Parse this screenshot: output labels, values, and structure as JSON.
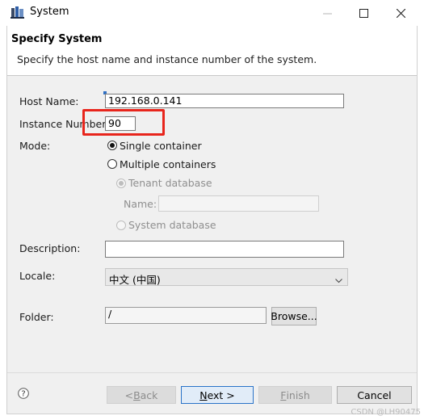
{
  "window": {
    "title": "System",
    "icon": "system-app-icon",
    "controls": [
      "minimize",
      "maximize",
      "close"
    ]
  },
  "header": {
    "title": "Specify System",
    "description": "Specify the host name and instance number of the system."
  },
  "form": {
    "host_name_label": "Host Name:",
    "host_name_value": "192.168.0.141",
    "instance_number_label": "Instance Number:",
    "instance_number_value": "90",
    "mode_label": "Mode:",
    "mode_single": "Single container",
    "mode_multiple": "Multiple containers",
    "mode_selected": "Single container",
    "tenant_database": "Tenant database",
    "name_label": "Name:",
    "name_value": "",
    "system_database": "System database",
    "description_label": "Description:",
    "description_value": "",
    "locale_label": "Locale:",
    "locale_value": "中文 (中国)",
    "folder_label": "Folder:",
    "folder_value": "/",
    "browse_label": "Browse..."
  },
  "buttons": {
    "back": "< Back",
    "next": "Next >",
    "finish": "Finish",
    "cancel": "Cancel"
  },
  "watermark": "CSDN @LH90475",
  "colors": {
    "highlight": "#e8251c",
    "default_button_border": "#2a73c8",
    "dialog_background": "#f0f0f0"
  }
}
